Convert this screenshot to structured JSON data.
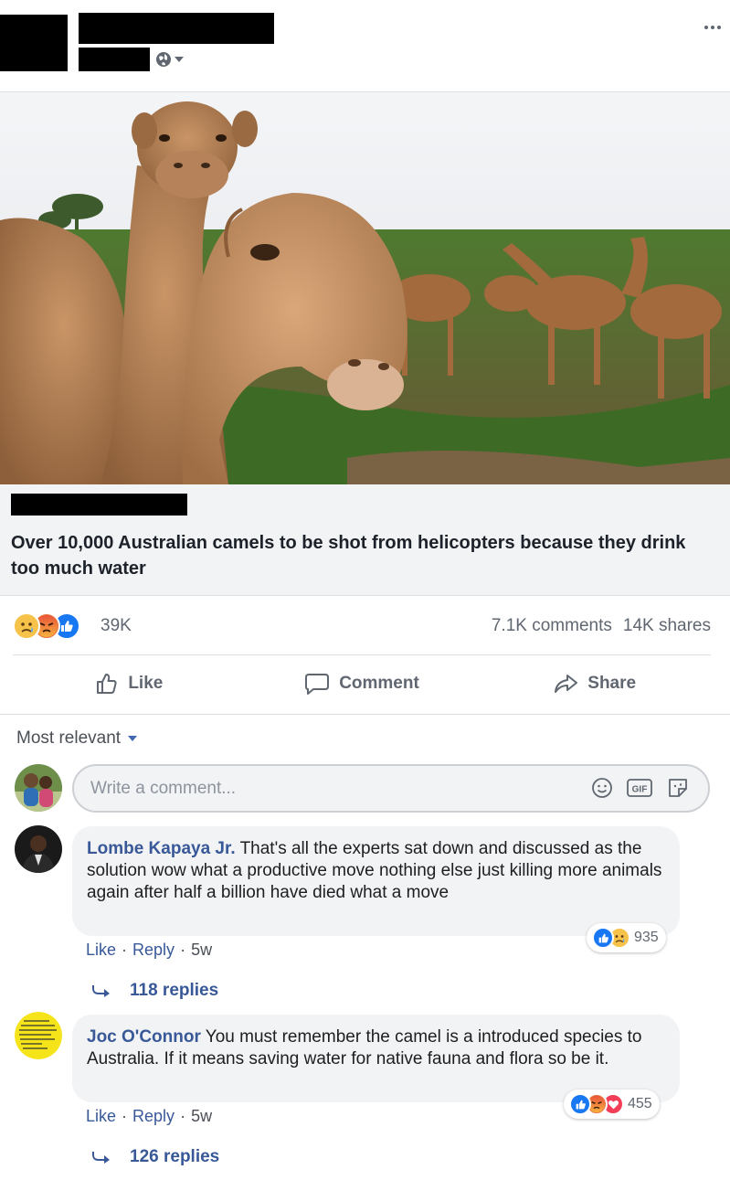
{
  "post": {
    "link_title": "Over 10,000 Australian camels to be shot from helicopters because they drink too much water"
  },
  "stats": {
    "reaction_count": "39K",
    "comments": "7.1K comments",
    "shares": "14K shares",
    "reactions": [
      "sad",
      "angry",
      "like"
    ]
  },
  "actions": {
    "like": "Like",
    "comment": "Comment",
    "share": "Share"
  },
  "sort": {
    "label": "Most relevant"
  },
  "composer": {
    "placeholder": "Write a comment..."
  },
  "comments": [
    {
      "author": "Lombe Kapaya Jr.",
      "text": "That's all the experts sat down and discussed as the solution wow what a productive move nothing else just killing more animals again after half a billion have died what a move",
      "like": "Like",
      "reply": "Reply",
      "time": "5w",
      "reaction_count": "935",
      "reactions": [
        "like",
        "sad"
      ],
      "replies": "118 replies"
    },
    {
      "author": "Joc O'Connor",
      "text": "You must remember the camel is a introduced species to Australia. If it means saving water for native fauna and flora so be it.",
      "like": "Like",
      "reply": "Reply",
      "time": "5w",
      "reaction_count": "455",
      "reactions": [
        "like",
        "angry",
        "love"
      ],
      "replies": "126 replies"
    }
  ],
  "colors": {
    "link_blue": "#385898",
    "fb_blue": "#1877f2",
    "gray_text": "#606770",
    "bubble_bg": "#f2f3f5"
  }
}
